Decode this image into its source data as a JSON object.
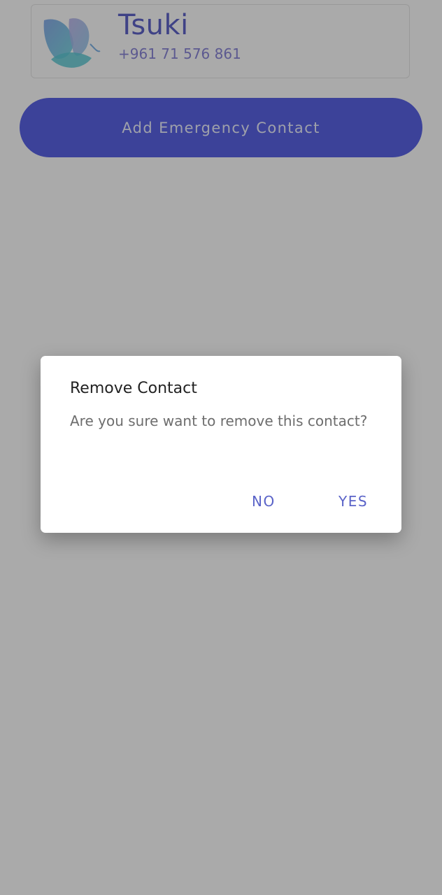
{
  "contact": {
    "name": "Tsuki",
    "phone": "+961 71 576 861",
    "avatar_icon": "butterfly-logo-icon"
  },
  "add_button": {
    "label": "Add Emergency Contact"
  },
  "dialog": {
    "title": "Remove Contact",
    "message": "Are you sure want to remove this contact?",
    "no_label": "NO",
    "yes_label": "YES"
  },
  "colors": {
    "accent": "#5b63e6",
    "dialog_button": "#5a63c8",
    "scrim": "rgba(0,0,0,0.335)"
  }
}
